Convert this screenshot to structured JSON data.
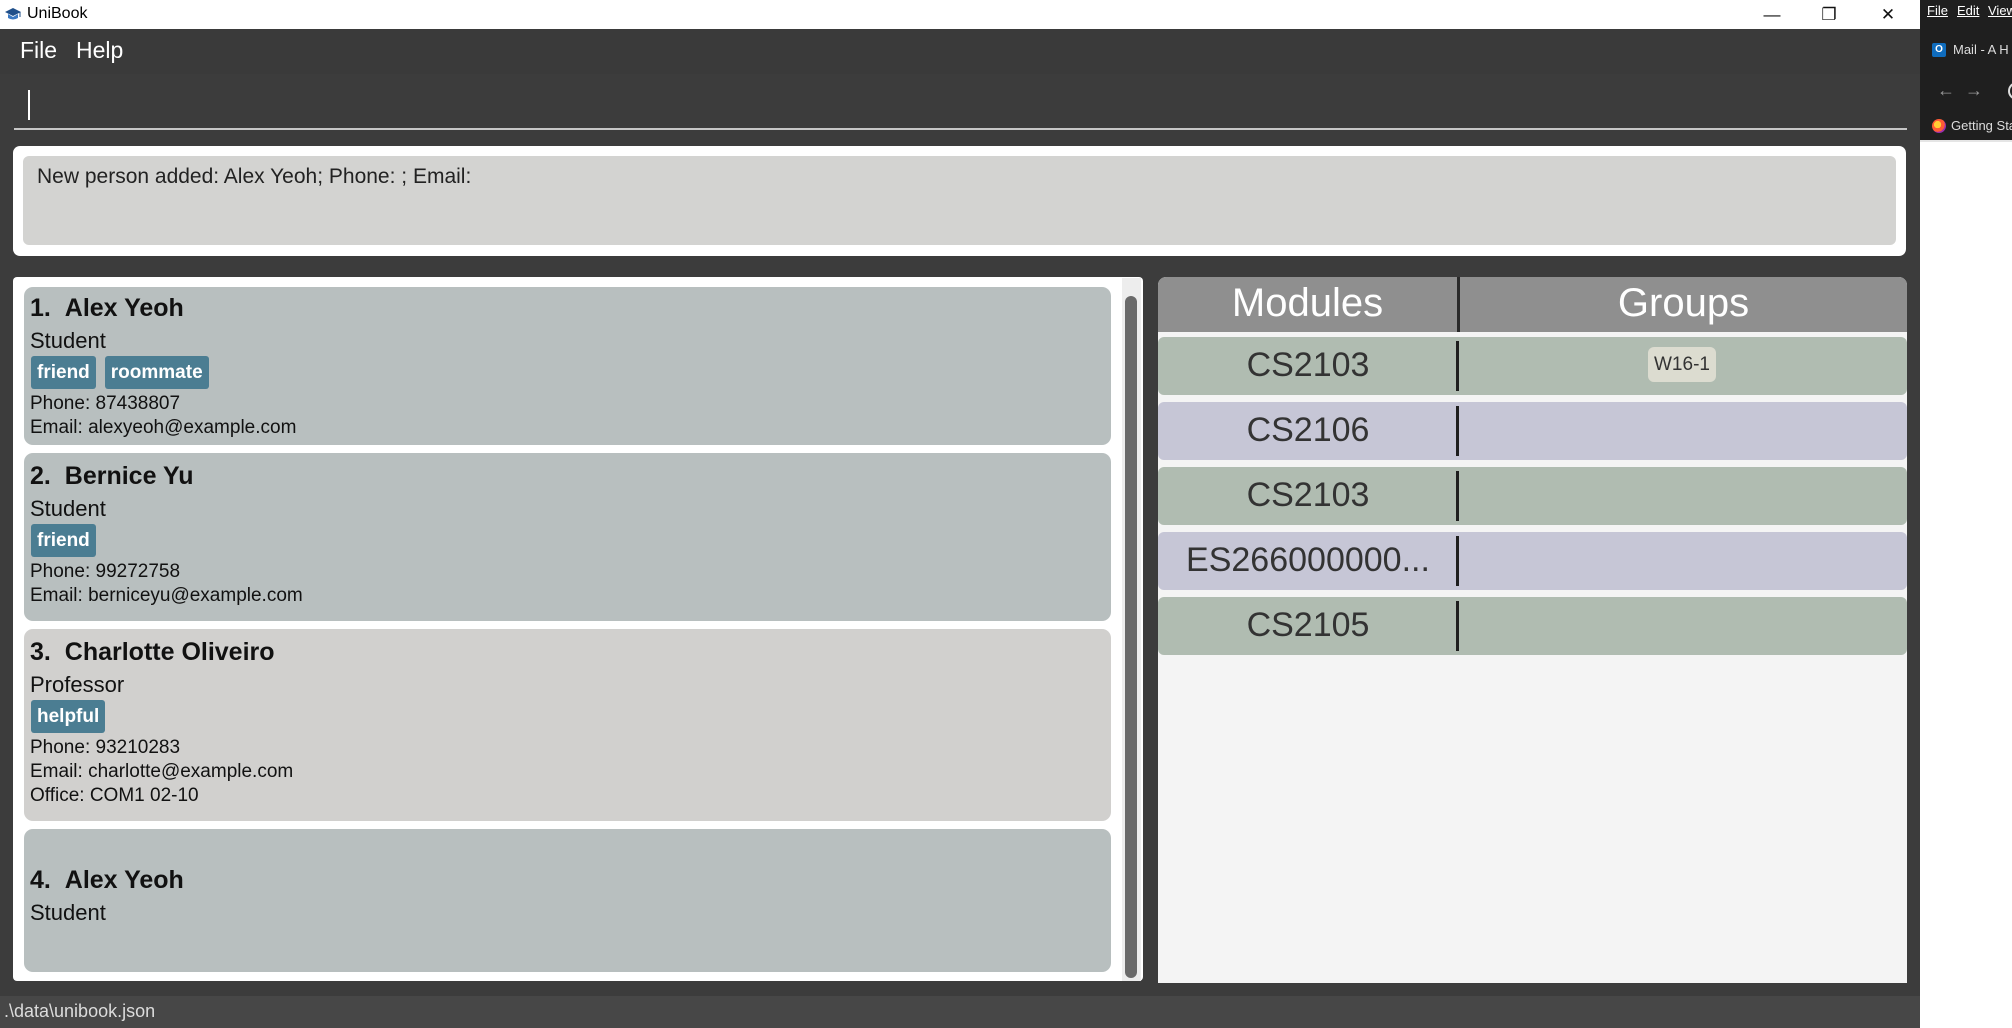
{
  "window": {
    "title": "UniBook",
    "icons": {
      "app": "graduation-cap-icon",
      "minimize": "minimize-icon",
      "maximize": "restore-icon",
      "close": "close-icon"
    },
    "minimize_glyph": "—",
    "maximize_glyph": "❐",
    "close_glyph": "✕"
  },
  "menubar": {
    "items": [
      "File",
      "Help"
    ]
  },
  "command": {
    "value": "",
    "placeholder": ""
  },
  "result": {
    "text": "New person added: Alex Yeoh; Phone: ; Email:"
  },
  "persons": [
    {
      "index": "1.",
      "name": "Alex Yeoh",
      "role": "Student",
      "tags": [
        "friend",
        "roommate"
      ],
      "phone": "Phone: 87438807",
      "email": "Email: alexyeoh@example.com"
    },
    {
      "index": "2.",
      "name": "Bernice Yu",
      "role": "Student",
      "tags": [
        "friend"
      ],
      "phone": "Phone: 99272758",
      "email": "Email: berniceyu@example.com"
    },
    {
      "index": "3.",
      "name": "Charlotte Oliveiro",
      "role": "Professor",
      "tags": [
        "helpful"
      ],
      "phone": "Phone: 93210283",
      "email": "Email: charlotte@example.com",
      "office": "Office: COM1 02-10"
    },
    {
      "index": "4.",
      "name": "Alex Yeoh",
      "role": "Student",
      "tags": []
    }
  ],
  "modules_table": {
    "headers": {
      "modules": "Modules",
      "groups": "Groups"
    },
    "rows": [
      {
        "code": "CS2103",
        "groups": [
          "W16-1"
        ],
        "color": "#b0bcb1"
      },
      {
        "code": "CS2106",
        "groups": [],
        "color": "#c6c6d6"
      },
      {
        "code": "CS2103",
        "groups": [],
        "color": "#b0bcb1"
      },
      {
        "code": "ES266000000...",
        "groups": [],
        "color": "#c6c6d6"
      },
      {
        "code": "CS2105",
        "groups": [],
        "color": "#b0bcb1"
      }
    ]
  },
  "statusbar": {
    "path": ".\\data\\unibook.json"
  },
  "background_window": {
    "menus": [
      "File",
      "Edit",
      "View"
    ],
    "tab_label": "Mail - A H I",
    "back_glyph": "←",
    "forward_glyph": "→",
    "bookmark": "Getting Star",
    "icons": {
      "tab": "outlook-icon",
      "bookmark": "firefox-icon",
      "back": "back-arrow-icon",
      "forward": "forward-arrow-icon"
    }
  },
  "colors": {
    "tag": "#4b7d92",
    "card_default": "#b8bfbf",
    "card_alt": "#d1d0ce",
    "module_row_green": "#b0bcb1",
    "module_row_lavender": "#c6c6d6",
    "header": "#8f8f8f"
  }
}
